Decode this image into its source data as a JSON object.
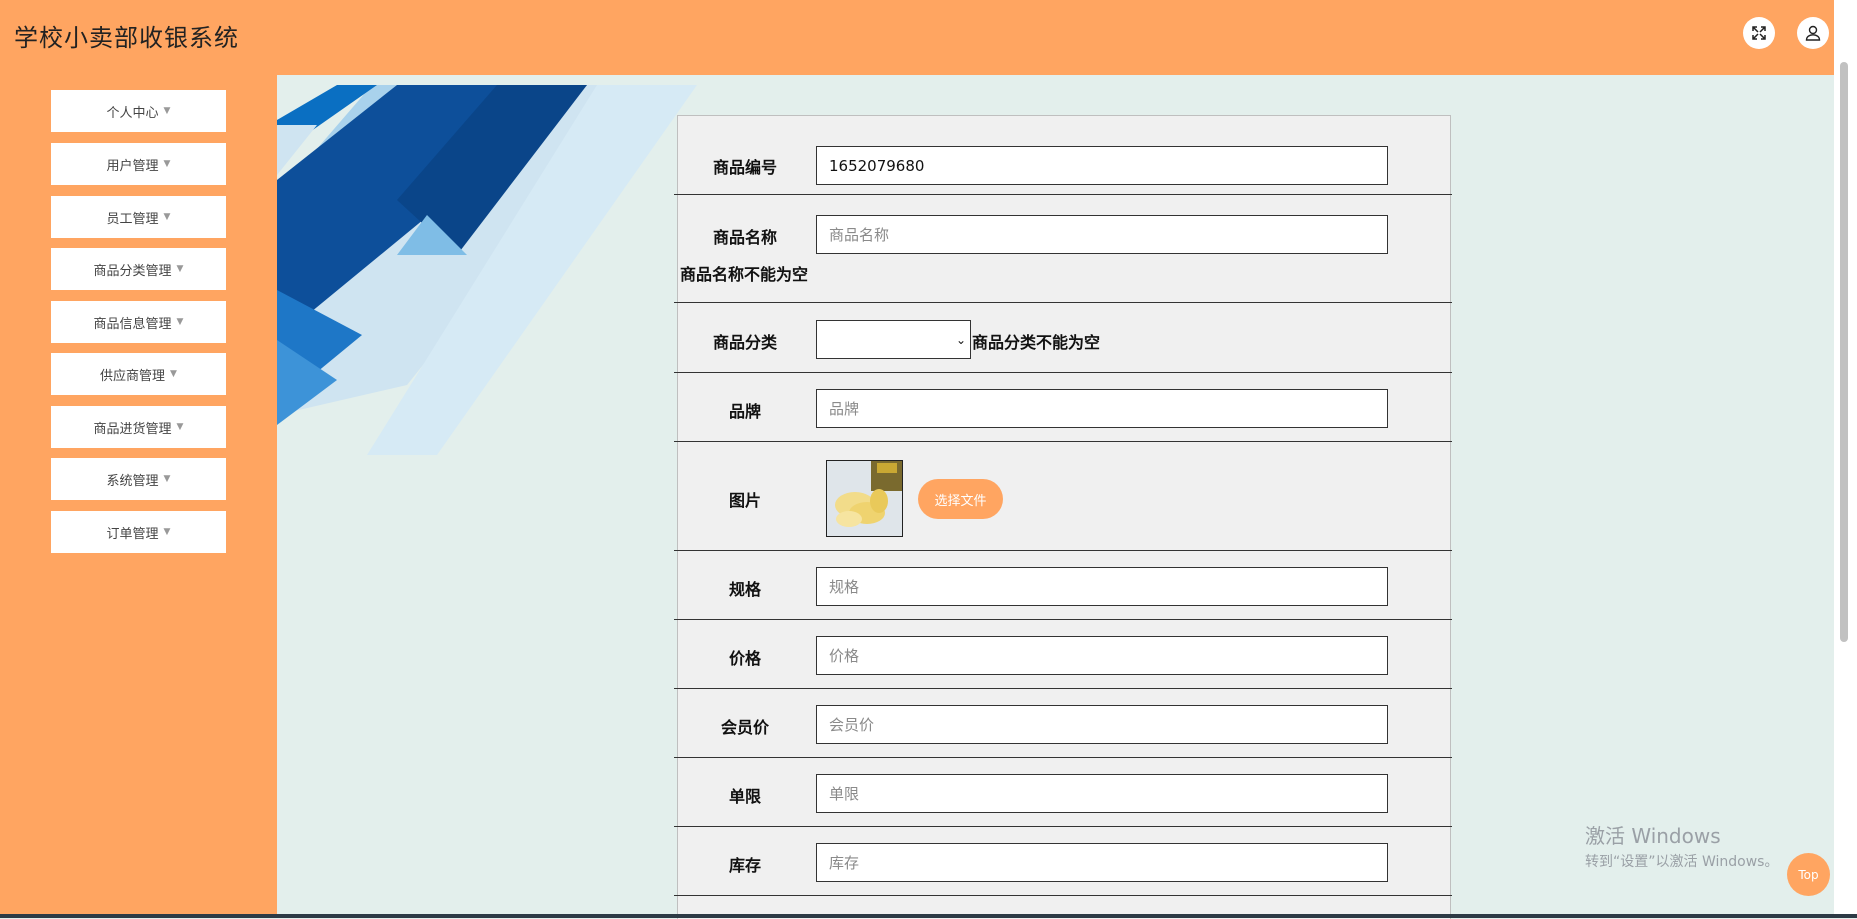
{
  "app": {
    "title": "学校小卖部收银系统"
  },
  "header": {
    "icons": [
      "fullscreen-icon",
      "user-icon"
    ]
  },
  "sidebar": {
    "items": [
      {
        "label": "个人中心"
      },
      {
        "label": "用户管理"
      },
      {
        "label": "员工管理"
      },
      {
        "label": "商品分类管理"
      },
      {
        "label": "商品信息管理"
      },
      {
        "label": "供应商管理"
      },
      {
        "label": "商品进货管理"
      },
      {
        "label": "系统管理"
      },
      {
        "label": "订单管理"
      }
    ]
  },
  "form": {
    "product_code": {
      "label": "商品编号",
      "value": "1652079680"
    },
    "product_name": {
      "label": "商品名称",
      "placeholder": "商品名称",
      "error": "商品名称不能为空"
    },
    "category": {
      "label": "商品分类",
      "value": "",
      "error": "商品分类不能为空"
    },
    "brand": {
      "label": "品牌",
      "placeholder": "品牌"
    },
    "image": {
      "label": "图片",
      "button_label": "选择文件"
    },
    "spec": {
      "label": "规格",
      "placeholder": "规格"
    },
    "price": {
      "label": "价格",
      "placeholder": "价格"
    },
    "member_price": {
      "label": "会员价",
      "placeholder": "会员价"
    },
    "limit": {
      "label": "单限",
      "placeholder": "单限"
    },
    "stock": {
      "label": "库存",
      "placeholder": "库存"
    }
  },
  "watermark": {
    "title": "激活 Windows",
    "subtitle": "转到“设置”以激活 Windows。"
  },
  "back_to_top": {
    "label": "Top"
  },
  "colors": {
    "accent": "#ffa561",
    "content_bg": "#e3efec",
    "card_bg": "#f0f0f0",
    "hero_dark": "#0d4f9a"
  }
}
